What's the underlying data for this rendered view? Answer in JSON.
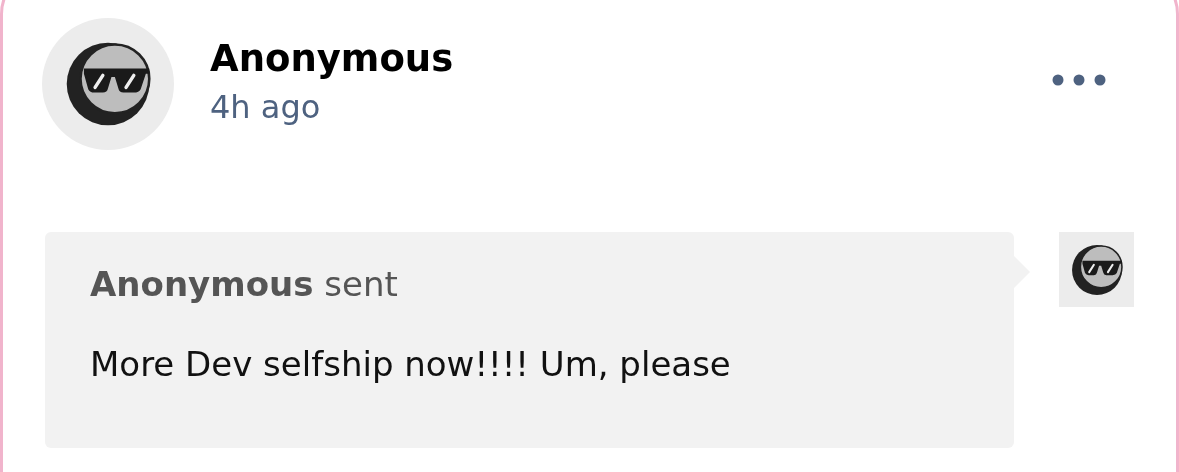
{
  "post": {
    "author": "Anonymous",
    "time": "4h ago"
  },
  "message": {
    "header": "**Anonymous** sent",
    "body": "More Dev selfship now!!!! Um, please"
  }
}
